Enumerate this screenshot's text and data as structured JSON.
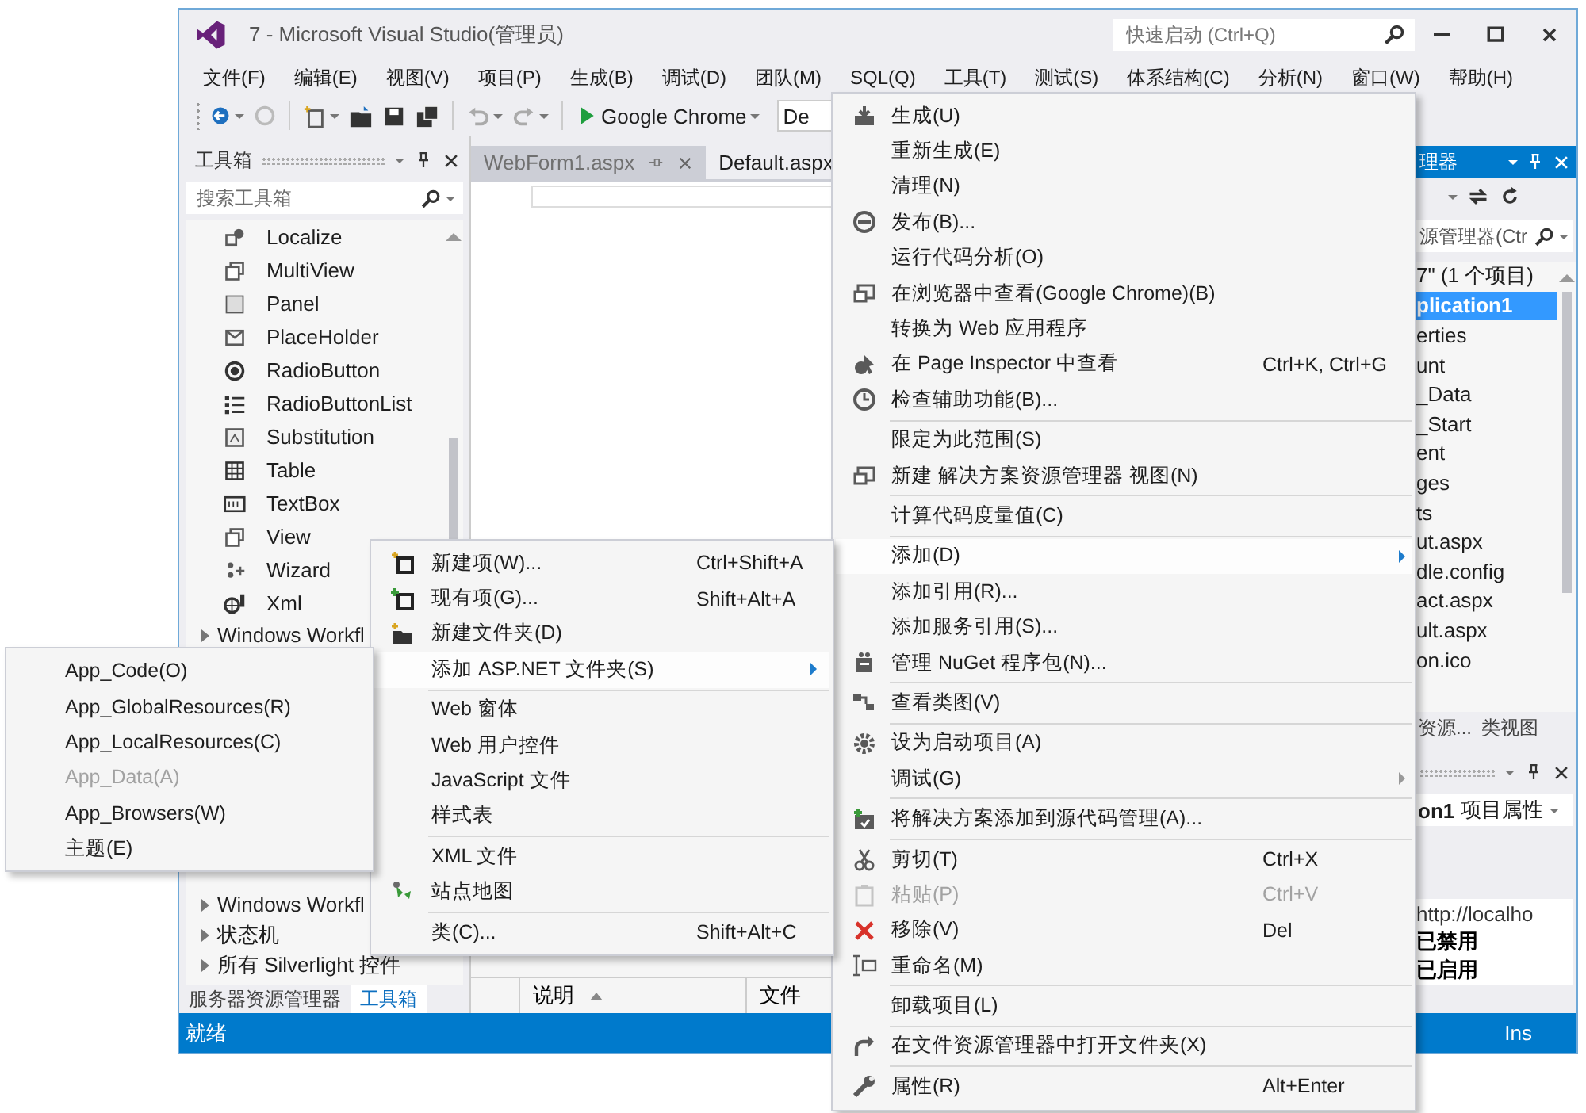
{
  "window": {
    "title": "7 - Microsoft Visual Studio(管理员)",
    "quick_launch": {
      "placeholder": "快速启动 (Ctrl+Q)"
    }
  },
  "menu_bar": [
    "文件(F)",
    "编辑(E)",
    "视图(V)",
    "项目(P)",
    "生成(B)",
    "调试(D)",
    "团队(M)",
    "SQL(Q)",
    "工具(T)",
    "测试(S)",
    "体系结构(C)",
    "分析(N)",
    "窗口(W)",
    "帮助(H)"
  ],
  "toolbar": {
    "run_target": "Google Chrome",
    "configuration": "De"
  },
  "toolbox": {
    "title": "工具箱",
    "search": {
      "placeholder": "搜索工具箱"
    },
    "items": [
      "Localize",
      "MultiView",
      "Panel",
      "PlaceHolder",
      "RadioButton",
      "RadioButtonList",
      "Substitution",
      "Table",
      "TextBox",
      "View",
      "Wizard",
      "Xml"
    ],
    "groups_top": [
      {
        "label": "Windows Workfl",
        "expanded": false
      }
    ],
    "groups_bottom": [
      {
        "label": "Windows Workfl",
        "expanded": false
      },
      {
        "label": "状态机",
        "expanded": false
      },
      {
        "label": "所有 Silverlight 控件",
        "expanded": false
      }
    ],
    "tabs": [
      {
        "label": "服务器资源管理器",
        "selected": false
      },
      {
        "label": "工具箱",
        "selected": true
      }
    ]
  },
  "editor": {
    "tabs": [
      {
        "label": "WebForm1.aspx",
        "selected": false
      },
      {
        "label": "Default.aspx",
        "selected": true
      }
    ]
  },
  "error_list": {
    "columns": [
      {
        "label": "说明",
        "sorted": true
      },
      {
        "label": "文件",
        "sorted": false
      }
    ]
  },
  "solution_explorer": {
    "title": "理器",
    "search": {
      "placeholder": "源管理器(Ctr"
    },
    "tree": [
      {
        "label": "7\"  (1 个项目)",
        "selected": false
      },
      {
        "label": "plication1",
        "selected": true
      },
      {
        "label": "erties",
        "selected": false
      },
      {
        "label": "unt",
        "selected": false
      },
      {
        "label": "_Data",
        "selected": false
      },
      {
        "label": "_Start",
        "selected": false
      },
      {
        "label": "ent",
        "selected": false
      },
      {
        "label": "ges",
        "selected": false
      },
      {
        "label": "ts",
        "selected": false
      },
      {
        "label": "ut.aspx",
        "selected": false
      },
      {
        "label": "dle.config",
        "selected": false
      },
      {
        "label": "act.aspx",
        "selected": false
      },
      {
        "label": "ult.aspx",
        "selected": false
      },
      {
        "label": "on.ico",
        "selected": false
      }
    ],
    "tabs": [
      {
        "label": "资源...",
        "selected": false
      },
      {
        "label": "类视图",
        "selected": false
      }
    ]
  },
  "properties": {
    "object": "**on1** 项目属性",
    "values": [
      {
        "text": "http://localho",
        "modified": false
      },
      {
        "text": "已禁用",
        "modified": true
      },
      {
        "text": "已启用",
        "modified": true
      }
    ]
  },
  "status_bar": {
    "left": "就绪",
    "right": "Ins"
  },
  "context_menu": [
    {
      "kind": "item",
      "label": "生成(U)",
      "selected": false,
      "disabled": false,
      "submenu": false
    },
    {
      "kind": "item",
      "label": "重新生成(E)",
      "selected": false,
      "disabled": false,
      "submenu": false
    },
    {
      "kind": "item",
      "label": "清理(N)",
      "selected": false,
      "disabled": false,
      "submenu": false
    },
    {
      "kind": "item",
      "label": "发布(B)...",
      "selected": false,
      "disabled": false,
      "submenu": false
    },
    {
      "kind": "item",
      "label": "运行代码分析(O)",
      "selected": false,
      "disabled": false,
      "submenu": false
    },
    {
      "kind": "item",
      "label": "在浏览器中查看(Google Chrome)(B)",
      "selected": false,
      "disabled": false,
      "submenu": false
    },
    {
      "kind": "item",
      "label": "转换为 Web 应用程序",
      "selected": false,
      "disabled": false,
      "submenu": false
    },
    {
      "kind": "item",
      "label": "在 Page Inspector 中查看",
      "shortcut": "Ctrl+K, Ctrl+G",
      "selected": false,
      "disabled": false,
      "submenu": false
    },
    {
      "kind": "item",
      "label": "检查辅助功能(B)...",
      "selected": false,
      "disabled": false,
      "submenu": false
    },
    {
      "kind": "separator"
    },
    {
      "kind": "item",
      "label": "限定为此范围(S)",
      "selected": false,
      "disabled": false,
      "submenu": false
    },
    {
      "kind": "item",
      "label": "新建 解决方案资源管理器 视图(N)",
      "selected": false,
      "disabled": false,
      "submenu": false
    },
    {
      "kind": "separator"
    },
    {
      "kind": "item",
      "label": "计算代码度量值(C)",
      "selected": false,
      "disabled": false,
      "submenu": false
    },
    {
      "kind": "separator"
    },
    {
      "kind": "item",
      "label": "添加(D)",
      "selected": true,
      "disabled": false,
      "submenu": true
    },
    {
      "kind": "item",
      "label": "添加引用(R)...",
      "selected": false,
      "disabled": false,
      "submenu": false
    },
    {
      "kind": "item",
      "label": "添加服务引用(S)...",
      "selected": false,
      "disabled": false,
      "submenu": false
    },
    {
      "kind": "item",
      "label": "管理 NuGet 程序包(N)...",
      "selected": false,
      "disabled": false,
      "submenu": false
    },
    {
      "kind": "separator"
    },
    {
      "kind": "item",
      "label": "查看类图(V)",
      "selected": false,
      "disabled": false,
      "submenu": false
    },
    {
      "kind": "separator"
    },
    {
      "kind": "item",
      "label": "设为启动项目(A)",
      "selected": false,
      "disabled": false,
      "submenu": false
    },
    {
      "kind": "item",
      "label": "调试(G)",
      "selected": false,
      "disabled": false,
      "submenu": true
    },
    {
      "kind": "separator"
    },
    {
      "kind": "item",
      "label": "将解决方案添加到源代码管理(A)...",
      "selected": false,
      "disabled": false,
      "submenu": false
    },
    {
      "kind": "separator"
    },
    {
      "kind": "item",
      "label": "剪切(T)",
      "shortcut": "Ctrl+X",
      "selected": false,
      "disabled": false,
      "submenu": false
    },
    {
      "kind": "item",
      "label": "粘贴(P)",
      "shortcut": "Ctrl+V",
      "selected": false,
      "disabled": true,
      "submenu": false
    },
    {
      "kind": "item",
      "label": "移除(V)",
      "shortcut": "Del",
      "selected": false,
      "disabled": false,
      "submenu": false
    },
    {
      "kind": "item",
      "label": "重命名(M)",
      "selected": false,
      "disabled": false,
      "submenu": false
    },
    {
      "kind": "separator"
    },
    {
      "kind": "item",
      "label": "卸载项目(L)",
      "selected": false,
      "disabled": false,
      "submenu": false
    },
    {
      "kind": "separator"
    },
    {
      "kind": "item",
      "label": "在文件资源管理器中打开文件夹(X)",
      "selected": false,
      "disabled": false,
      "submenu": false
    },
    {
      "kind": "separator"
    },
    {
      "kind": "item",
      "label": "属性(R)",
      "shortcut": "Alt+Enter",
      "selected": false,
      "disabled": false,
      "submenu": false
    }
  ],
  "add_submenu": [
    {
      "kind": "item",
      "label": "新建项(W)...",
      "shortcut": "Ctrl+Shift+A",
      "selected": false,
      "disabled": false,
      "submenu": false
    },
    {
      "kind": "item",
      "label": "现有项(G)...",
      "shortcut": "Shift+Alt+A",
      "selected": false,
      "disabled": false,
      "submenu": false
    },
    {
      "kind": "item",
      "label": "新建文件夹(D)",
      "selected": false,
      "disabled": false,
      "submenu": false
    },
    {
      "kind": "item",
      "label": "添加 ASP.NET 文件夹(S)",
      "selected": true,
      "disabled": false,
      "submenu": true
    },
    {
      "kind": "separator"
    },
    {
      "kind": "item",
      "label": "Web 窗体",
      "selected": false,
      "disabled": false,
      "submenu": false
    },
    {
      "kind": "item",
      "label": "Web 用户控件",
      "selected": false,
      "disabled": false,
      "submenu": false
    },
    {
      "kind": "item",
      "label": "JavaScript 文件",
      "selected": false,
      "disabled": false,
      "submenu": false
    },
    {
      "kind": "item",
      "label": "样式表",
      "selected": false,
      "disabled": false,
      "submenu": false
    },
    {
      "kind": "separator"
    },
    {
      "kind": "item",
      "label": "XML 文件",
      "selected": false,
      "disabled": false,
      "submenu": false
    },
    {
      "kind": "item",
      "label": "站点地图",
      "selected": false,
      "disabled": false,
      "submenu": false
    },
    {
      "kind": "separator"
    },
    {
      "kind": "item",
      "label": "类(C)...",
      "shortcut": "Shift+Alt+C",
      "selected": false,
      "disabled": false,
      "submenu": false
    }
  ],
  "asp_net_folder_submenu": [
    {
      "kind": "item",
      "label": "App_Code(O)",
      "selected": false,
      "disabled": false,
      "submenu": false
    },
    {
      "kind": "item",
      "label": "App_GlobalResources(R)",
      "selected": false,
      "disabled": false,
      "submenu": false
    },
    {
      "kind": "item",
      "label": "App_LocalResources(C)",
      "selected": false,
      "disabled": false,
      "submenu": false
    },
    {
      "kind": "item",
      "label": "App_Data(A)",
      "selected": false,
      "disabled": true,
      "submenu": false
    },
    {
      "kind": "item",
      "label": "App_Browsers(W)",
      "selected": false,
      "disabled": false,
      "submenu": false
    },
    {
      "kind": "item",
      "label": "主题(E)",
      "selected": false,
      "disabled": false,
      "submenu": false
    }
  ]
}
